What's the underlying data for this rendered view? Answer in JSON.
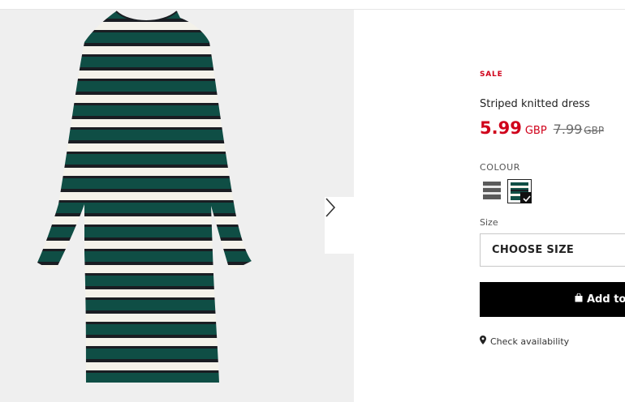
{
  "product": {
    "badge": "SALE",
    "name": "Striped knitted dress",
    "price_now": "5.99",
    "price_now_currency": "GBP",
    "price_old": "7.99",
    "price_old_currency": "GBP"
  },
  "colour": {
    "label": "COLOUR",
    "swatches": [
      {
        "name": "grey-stripe",
        "selected": false,
        "icon": "grey-stripe-swatch"
      },
      {
        "name": "green-stripe",
        "selected": true,
        "icon": "green-stripe-swatch"
      }
    ]
  },
  "size": {
    "label": "Size",
    "placeholder": "CHOOSE SIZE"
  },
  "cart": {
    "add_label": "Add to"
  },
  "availability": {
    "label": "Check availability"
  },
  "colors": {
    "sale_red": "#d0021b",
    "stripe_green": "#0f4e45",
    "stripe_black": "#1a1d22",
    "stripe_cream": "#f4f2ea",
    "button_black": "#000000"
  },
  "icons": {
    "next": "chevron-right-icon",
    "bag": "shopping-bag-icon",
    "pin": "location-pin-icon",
    "check": "check-icon"
  }
}
